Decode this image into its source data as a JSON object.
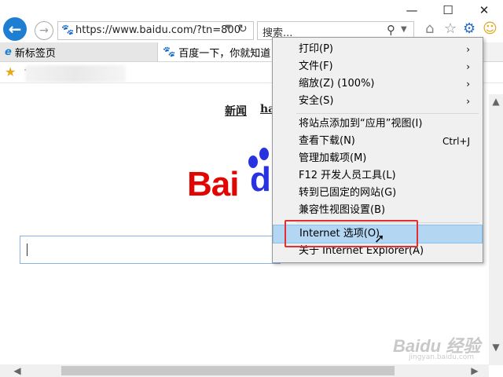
{
  "window": {
    "minimize": "—",
    "maximize": "☐",
    "close": "✕"
  },
  "nav": {
    "back": "←",
    "forward": "→",
    "address": "https://www.baidu.com/?tn=800",
    "address_icon": "🐾",
    "refresh": "↻",
    "search_placeholder": "搜索...",
    "search_icon": "⚲",
    "tools": {
      "home": "⌂",
      "favorites": "☆",
      "settings": "⚙",
      "smile": "☺"
    }
  },
  "tabs": [
    {
      "label": "新标签页",
      "icon": "e"
    },
    {
      "label": "百度一下，你就知道",
      "icon": "🐾"
    }
  ],
  "favorites": {
    "star": "★"
  },
  "page": {
    "links": [
      "新闻",
      "hao"
    ],
    "logo_bai": "Bai",
    "logo_du": "du",
    "watermark": "Baidu 经验",
    "watermark_sub": "jingyan.baidu.com"
  },
  "menu": {
    "items": [
      {
        "label": "打印(P)",
        "right": "›"
      },
      {
        "label": "文件(F)",
        "right": "›"
      },
      {
        "label": "缩放(Z) (100%)",
        "right": "›"
      },
      {
        "label": "安全(S)",
        "right": "›"
      },
      {
        "label": "将站点添加到“应用”视图(I)",
        "right": ""
      },
      {
        "label": "查看下载(N)",
        "right": "Ctrl+J"
      },
      {
        "label": "管理加载项(M)",
        "right": ""
      },
      {
        "label": "F12 开发人员工具(L)",
        "right": ""
      },
      {
        "label": "转到已固定的网站(G)",
        "right": ""
      },
      {
        "label": "兼容性视图设置(B)",
        "right": ""
      },
      {
        "label": "Internet 选项(O)",
        "right": ""
      },
      {
        "label": "关于 Internet Explorer(A)",
        "right": ""
      }
    ]
  },
  "scroll": {
    "up": "▲",
    "down": "▼",
    "left": "◀",
    "right": "▶"
  },
  "colors": {
    "accent": "#1e7fd2",
    "highlight": "#b3d7f3",
    "annotation": "#e23030",
    "baidu_red": "#e10602",
    "baidu_blue": "#2932e1"
  }
}
